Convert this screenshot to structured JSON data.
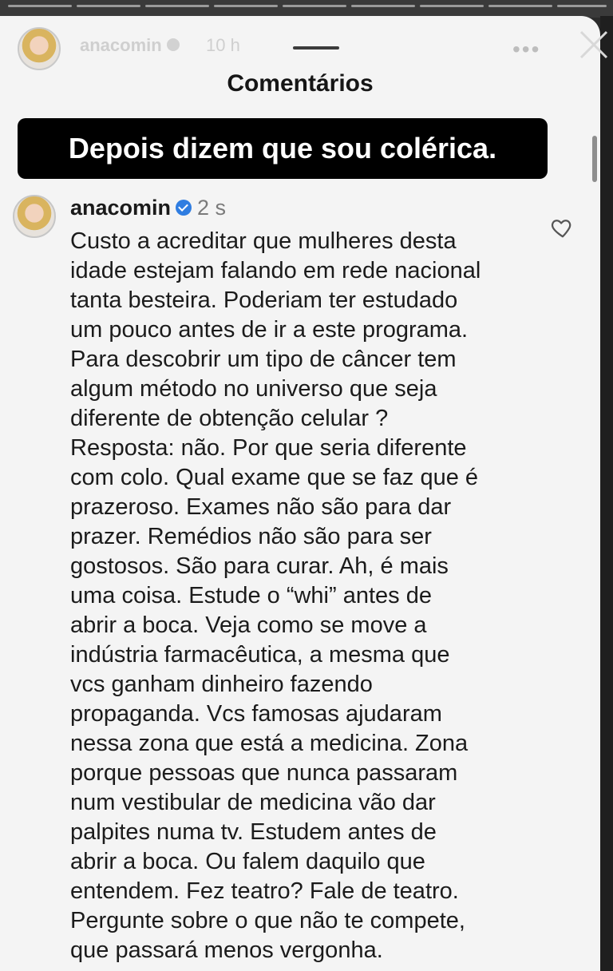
{
  "story": {
    "username": "anacomin",
    "time": "10 h",
    "more_icon": "more-horizontal-icon",
    "close_icon": "close-icon"
  },
  "sheet": {
    "title": "Comentários"
  },
  "caption": "Depois dizem que sou colérica.",
  "comment": {
    "username": "anacomin",
    "time": "2 s",
    "lines": [
      "Custo a acreditar que mulheres desta",
      "idade estejam falando em rede nacional",
      "tanta besteira. Poderiam ter estudado",
      "um pouco antes de ir a este programa.",
      "Para descobrir um tipo de câncer tem",
      "algum método no universo que seja",
      "diferente de obtenção celular ?",
      "Resposta: não. Por que seria diferente",
      "com colo. Qual exame que se faz que é",
      "prazeroso. Exames não são para dar",
      "prazer. Remédios não são para ser",
      "gostosos. São para curar. Ah, é mais",
      "uma coisa. Estude o “whi” antes de",
      "abrir a boca. Veja como se move a",
      "indústria farmacêutica, a mesma que",
      "vcs ganham dinheiro fazendo",
      "propaganda. Vcs famosas ajudaram",
      "nessa zona que está a medicina. Zona",
      "porque pessoas que nunca passaram",
      "num vestibular de medicina vão dar",
      "palpites numa tv. Estudem antes de",
      "abrir a boca. Ou falem daquilo que",
      "entendem. Fez teatro? Fale de teatro.",
      "Pergunte sobre o que não te compete,",
      "que passará menos vergonha."
    ]
  }
}
